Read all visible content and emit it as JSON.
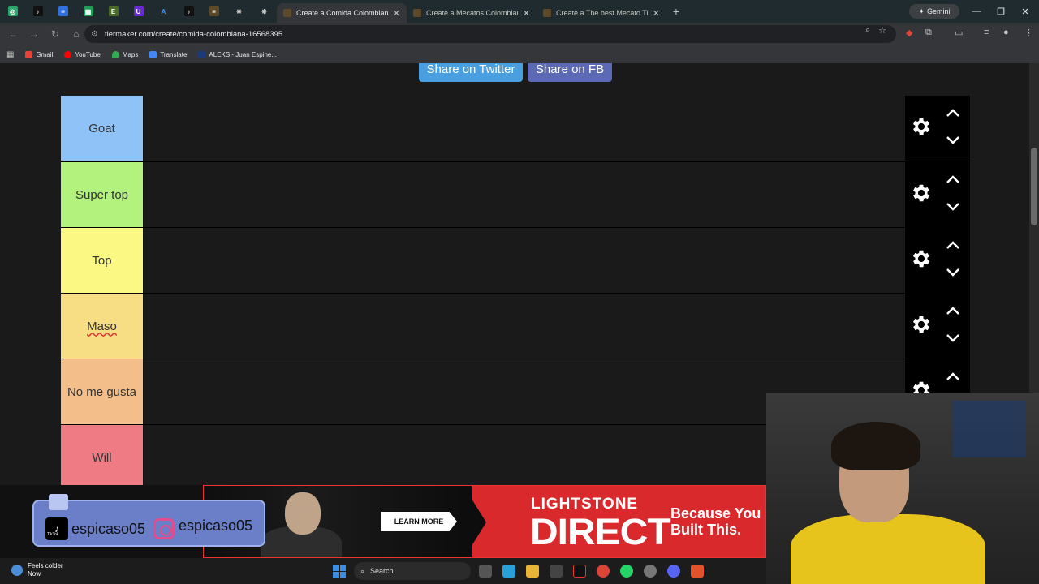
{
  "browser": {
    "tabs": [
      {
        "title": "Create a Comida Colombiana T",
        "active": true
      },
      {
        "title": "Create a Mecatos Colombianos",
        "active": false
      },
      {
        "title": "Create a The best Mecato Tier l",
        "active": false
      }
    ],
    "new_tab_glyph": "+",
    "close_glyph": "✕",
    "gemini_label": "Gemini",
    "url": "tiermaker.com/create/comida-colombiana-16568395",
    "bookmarks": [
      {
        "label": "Gmail",
        "color": "#ea4335"
      },
      {
        "label": "YouTube",
        "color": "#ff0000"
      },
      {
        "label": "Maps",
        "color": "#34a853"
      },
      {
        "label": "Translate",
        "color": "#4285f4"
      },
      {
        "label": "ALEKS - Juan Espine...",
        "color": "#1a3a7a"
      }
    ]
  },
  "share": {
    "twitter_label": "Share on Twitter",
    "fb_label": "Share on FB"
  },
  "tiers": [
    {
      "label": "Goat",
      "color": "#8fc3f7"
    },
    {
      "label": "Super top",
      "color": "#b3f27d"
    },
    {
      "label": "Top",
      "color": "#fbf884"
    },
    {
      "label": "Maso",
      "color": "#f7de84"
    },
    {
      "label": "No me gusta",
      "color": "#f4be8a"
    },
    {
      "label": "Will",
      "color": "#ef7c85"
    }
  ],
  "ad": {
    "cta": "LEARN MORE",
    "brand_top": "LIGHTSTONE",
    "brand_main": "DIRECT",
    "tagline_1": "Because You",
    "tagline_2": "Built This."
  },
  "socials": {
    "tiktok_handle": "espicaso05",
    "instagram_handle": "espicaso05",
    "tiktok_caption": "TikTok"
  },
  "taskbar": {
    "weather_line1": "Feels colder",
    "weather_line2": "Now",
    "search_placeholder": "Search"
  }
}
